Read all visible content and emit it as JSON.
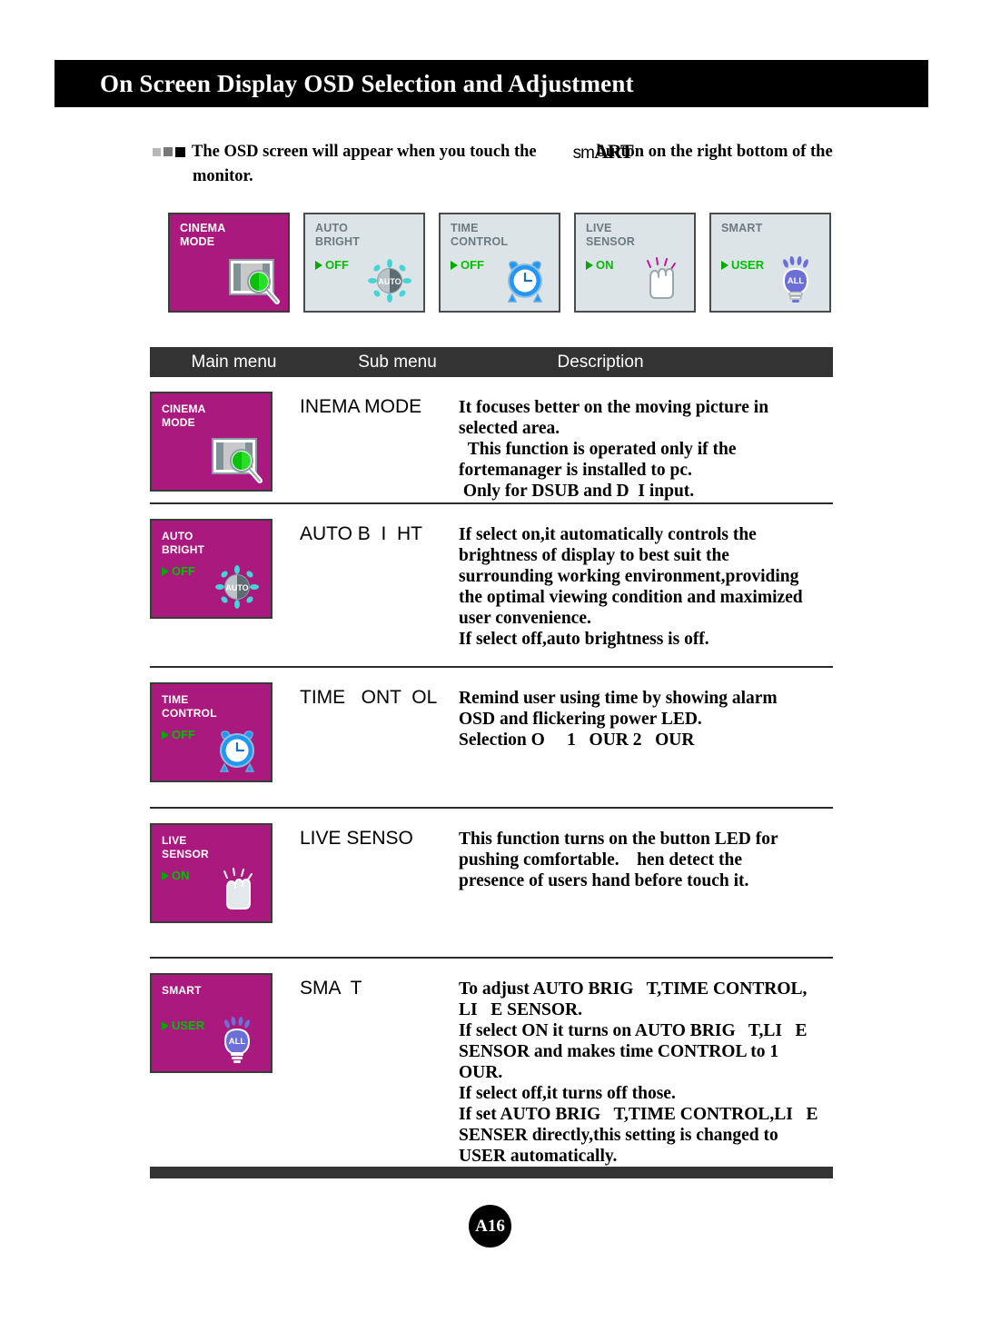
{
  "header": {
    "title": "On Screen Display OSD  Selection and Adjustment"
  },
  "intro": {
    "text_before": "The OSD screen will appear when you touch the",
    "smart_logo": "sm",
    "smart_logo_cap": "ART",
    "text_after": "button on the right bottom of the",
    "line2": "monitor."
  },
  "osd_panels": [
    {
      "label": "CINEMA\nMODE",
      "state": "",
      "art": "cinema-magnifier-icon",
      "highlight": true
    },
    {
      "label": "AUTO\nBRIGHT",
      "state": "OFF",
      "art": "auto-sun-icon",
      "highlight": false
    },
    {
      "label": "TIME\nCONTROL",
      "state": "OFF",
      "art": "alarm-clock-icon",
      "highlight": false
    },
    {
      "label": "LIVE\nSENSOR",
      "state": "ON",
      "art": "hand-touch-icon",
      "highlight": false
    },
    {
      "label": "SMART",
      "state": "USER",
      "art": "lightbulb-all-icon",
      "highlight": false
    }
  ],
  "table": {
    "headers": {
      "main": "Main menu",
      "sub": "Sub menu",
      "desc": "Description"
    },
    "rows": [
      {
        "panel": {
          "label": "CINEMA\nMODE",
          "state": "",
          "art": "cinema-magnifier-icon"
        },
        "sub": "INEMA MODE",
        "desc": "It focuses better on the moving picture in\nselected area.\n  This function is operated only if the\nfortemanager is installed to pc.\n Only for DSUB and D  I input."
      },
      {
        "panel": {
          "label": "AUTO\nBRIGHT",
          "state": "OFF",
          "art": "auto-sun-icon"
        },
        "sub": "AUTO B  I  HT",
        "desc": "If select on,it automatically controls the\nbrightness of display to best suit the\nsurrounding working environment,providing\nthe optimal viewing condition and maximized\nuser convenience.\nIf select off,auto brightness is off."
      },
      {
        "panel": {
          "label": "TIME\nCONTROL",
          "state": "OFF",
          "art": "alarm-clock-icon"
        },
        "sub": "TIME   ONT  OL",
        "desc": "Remind user using time by showing alarm\nOSD and flickering power LED.\nSelection O     1   OUR 2   OUR"
      },
      {
        "panel": {
          "label": "LIVE\nSENSOR",
          "state": "ON",
          "art": "hand-touch-icon"
        },
        "sub": "LIVE SENSO",
        "desc": "This function turns on the button LED for\npushing comfortable.    hen detect the\npresence of users hand before touch it."
      },
      {
        "panel": {
          "label": "SMART",
          "state": "USER",
          "art": "lightbulb-all-icon"
        },
        "sub": "SMA  T",
        "desc": "To adjust AUTO BRIG   T,TIME CONTROL,\nLI   E SENSOR.\nIf select ON it turns on AUTO BRIG   T,LI   E\nSENSOR and makes time CONTROL to 1   OUR.\nIf select off,it turns off those.\nIf set AUTO BRIG   T,TIME CONTROL,LI   E\nSENSER directly,this setting is changed to\nUSER automatically."
      }
    ]
  },
  "footer": {
    "page": "A16"
  },
  "colors": {
    "magenta": "#a9197e",
    "panel_bg": "#dde4e8",
    "green": "#00c000",
    "header_bar": "#333333",
    "black": "#000000"
  }
}
